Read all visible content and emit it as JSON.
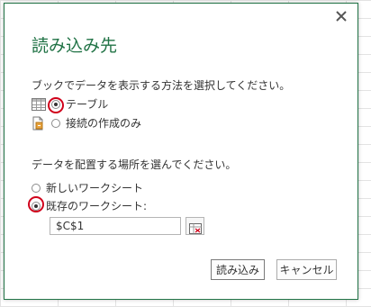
{
  "dialog": {
    "title": "読み込み先",
    "prompt_display": "ブックでデータを表示する方法を選択してください。",
    "display_options": [
      {
        "label": "テーブル",
        "icon": "table-icon",
        "selected": true
      },
      {
        "label": "接続の作成のみ",
        "icon": "connection-only-icon",
        "selected": false
      }
    ],
    "prompt_location": "データを配置する場所を選んでください。",
    "location_options": [
      {
        "label": "新しいワークシート",
        "selected": false
      },
      {
        "label": "既存のワークシート:",
        "selected": true
      }
    ],
    "cell_reference": "$C$1",
    "ok_label": "読み込み",
    "cancel_label": "キャンセル"
  },
  "colors": {
    "accent": "#217346",
    "highlight": "#d0021b"
  }
}
